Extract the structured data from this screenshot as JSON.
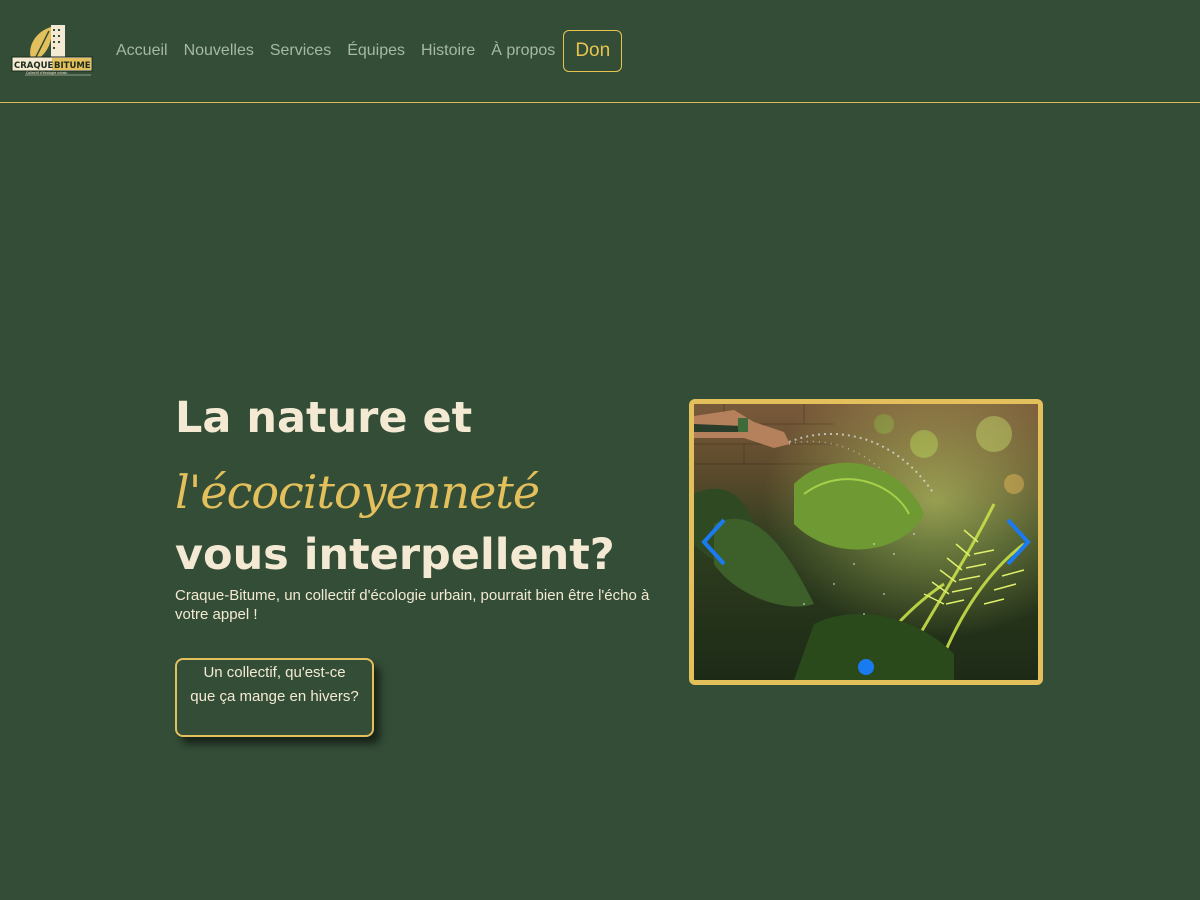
{
  "header": {
    "logo": {
      "name": "CRAQUE-BITUME",
      "text_left": "CRAQUE",
      "text_right": "BITUME",
      "tagline": "Collectif d'écologie urbain"
    },
    "nav": {
      "items": [
        {
          "label": "Accueil"
        },
        {
          "label": "Nouvelles"
        },
        {
          "label": "Services"
        },
        {
          "label": "Équipes"
        },
        {
          "label": "Histoire"
        },
        {
          "label": "À propos"
        }
      ],
      "don_label": "Don"
    }
  },
  "hero": {
    "title_line1": "La nature et",
    "title_line2": "l'écocitoyenneté",
    "title_line3": "vous interpellent?",
    "description": "Craque-Bitume, un collectif d'écologie urbain, pourrait bien être l'écho à votre appel !",
    "cta_label": "Un collectif, qu'est-ce que ça mange en hivers?"
  },
  "carousel": {
    "image_subject": "watering plants with a garden hose",
    "prev_icon": "chevron-left-icon",
    "next_icon": "chevron-right-icon",
    "slide_count": 1,
    "active_index": 0
  },
  "colors": {
    "background": "#334d37",
    "accent": "#e4c05d",
    "text": "#f4ead3",
    "nav_text": "#a7b8a5",
    "carousel_control": "#1a7bf0"
  }
}
